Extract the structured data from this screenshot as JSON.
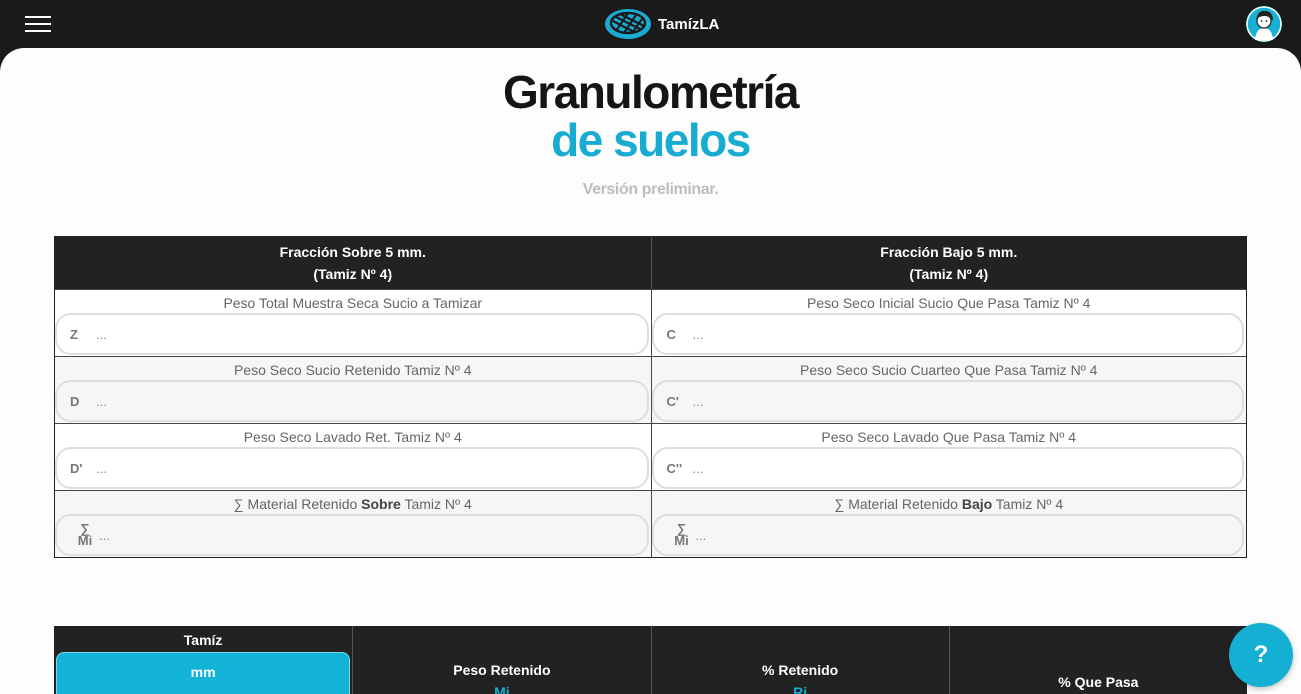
{
  "header": {
    "brand": "TamízLA",
    "menu_icon": "hamburger-icon",
    "logo_icon": "sieve-mesh-icon",
    "avatar_icon": "user-avatar-icon"
  },
  "page": {
    "title_line1": "Granulometría",
    "title_line2": "de suelos",
    "subtitle": "Versión preliminar."
  },
  "fraction_table": {
    "left_header": {
      "pre": "Fracción ",
      "strong": "Sobre",
      "post": " 5 mm.",
      "line2": "(Tamiz Nº 4)"
    },
    "right_header": {
      "pre": "Fracción ",
      "strong": "Bajo",
      "post": " 5 mm.",
      "line2": "(Tamiz Nº 4)"
    },
    "rows": [
      {
        "left": {
          "label": "Peso Total Muestra Seca Sucio a Tamizar",
          "symbol": "Z",
          "placeholder": "..."
        },
        "right": {
          "label": "Peso Seco Inicial Sucio Que Pasa Tamiz Nº 4",
          "symbol": "C",
          "placeholder": "..."
        }
      },
      {
        "left": {
          "label": "Peso Seco Sucio Retenido Tamiz Nº 4",
          "symbol": "D",
          "placeholder": "..."
        },
        "right": {
          "label": "Peso Seco Sucio Cuarteo Que Pasa Tamiz Nº 4",
          "symbol": "C'",
          "placeholder": "..."
        }
      },
      {
        "left": {
          "label": "Peso Seco Lavado Ret. Tamiz Nº 4",
          "symbol": "D'",
          "placeholder": "..."
        },
        "right": {
          "label": "Peso Seco Lavado Que Pasa Tamiz Nº 4",
          "symbol": "C''",
          "placeholder": "..."
        }
      },
      {
        "left": {
          "label_pre": "∑ Material Retenido ",
          "label_strong": "Sobre",
          "label_post": " Tamiz Nº 4",
          "symbol_top": "∑",
          "symbol_bottom": "Mi",
          "placeholder": "..."
        },
        "right": {
          "label_pre": "∑ Material Retenido ",
          "label_strong": "Bajo",
          "label_post": " Tamiz Nº 4",
          "symbol_top": "∑",
          "symbol_bottom": "Mi",
          "placeholder": "..."
        }
      }
    ]
  },
  "sieve_table": {
    "col1_title": "Tamíz",
    "unit_button": "mm",
    "col2_title": "Peso Retenido",
    "col2_sub": "Mi",
    "col3_title": "% Retenido",
    "col3_sub": "Ri",
    "col4_title": "% Que Pasa"
  },
  "help_button": "?",
  "colors": {
    "accent": "#19acd3",
    "dark": "#1a1a1a"
  }
}
